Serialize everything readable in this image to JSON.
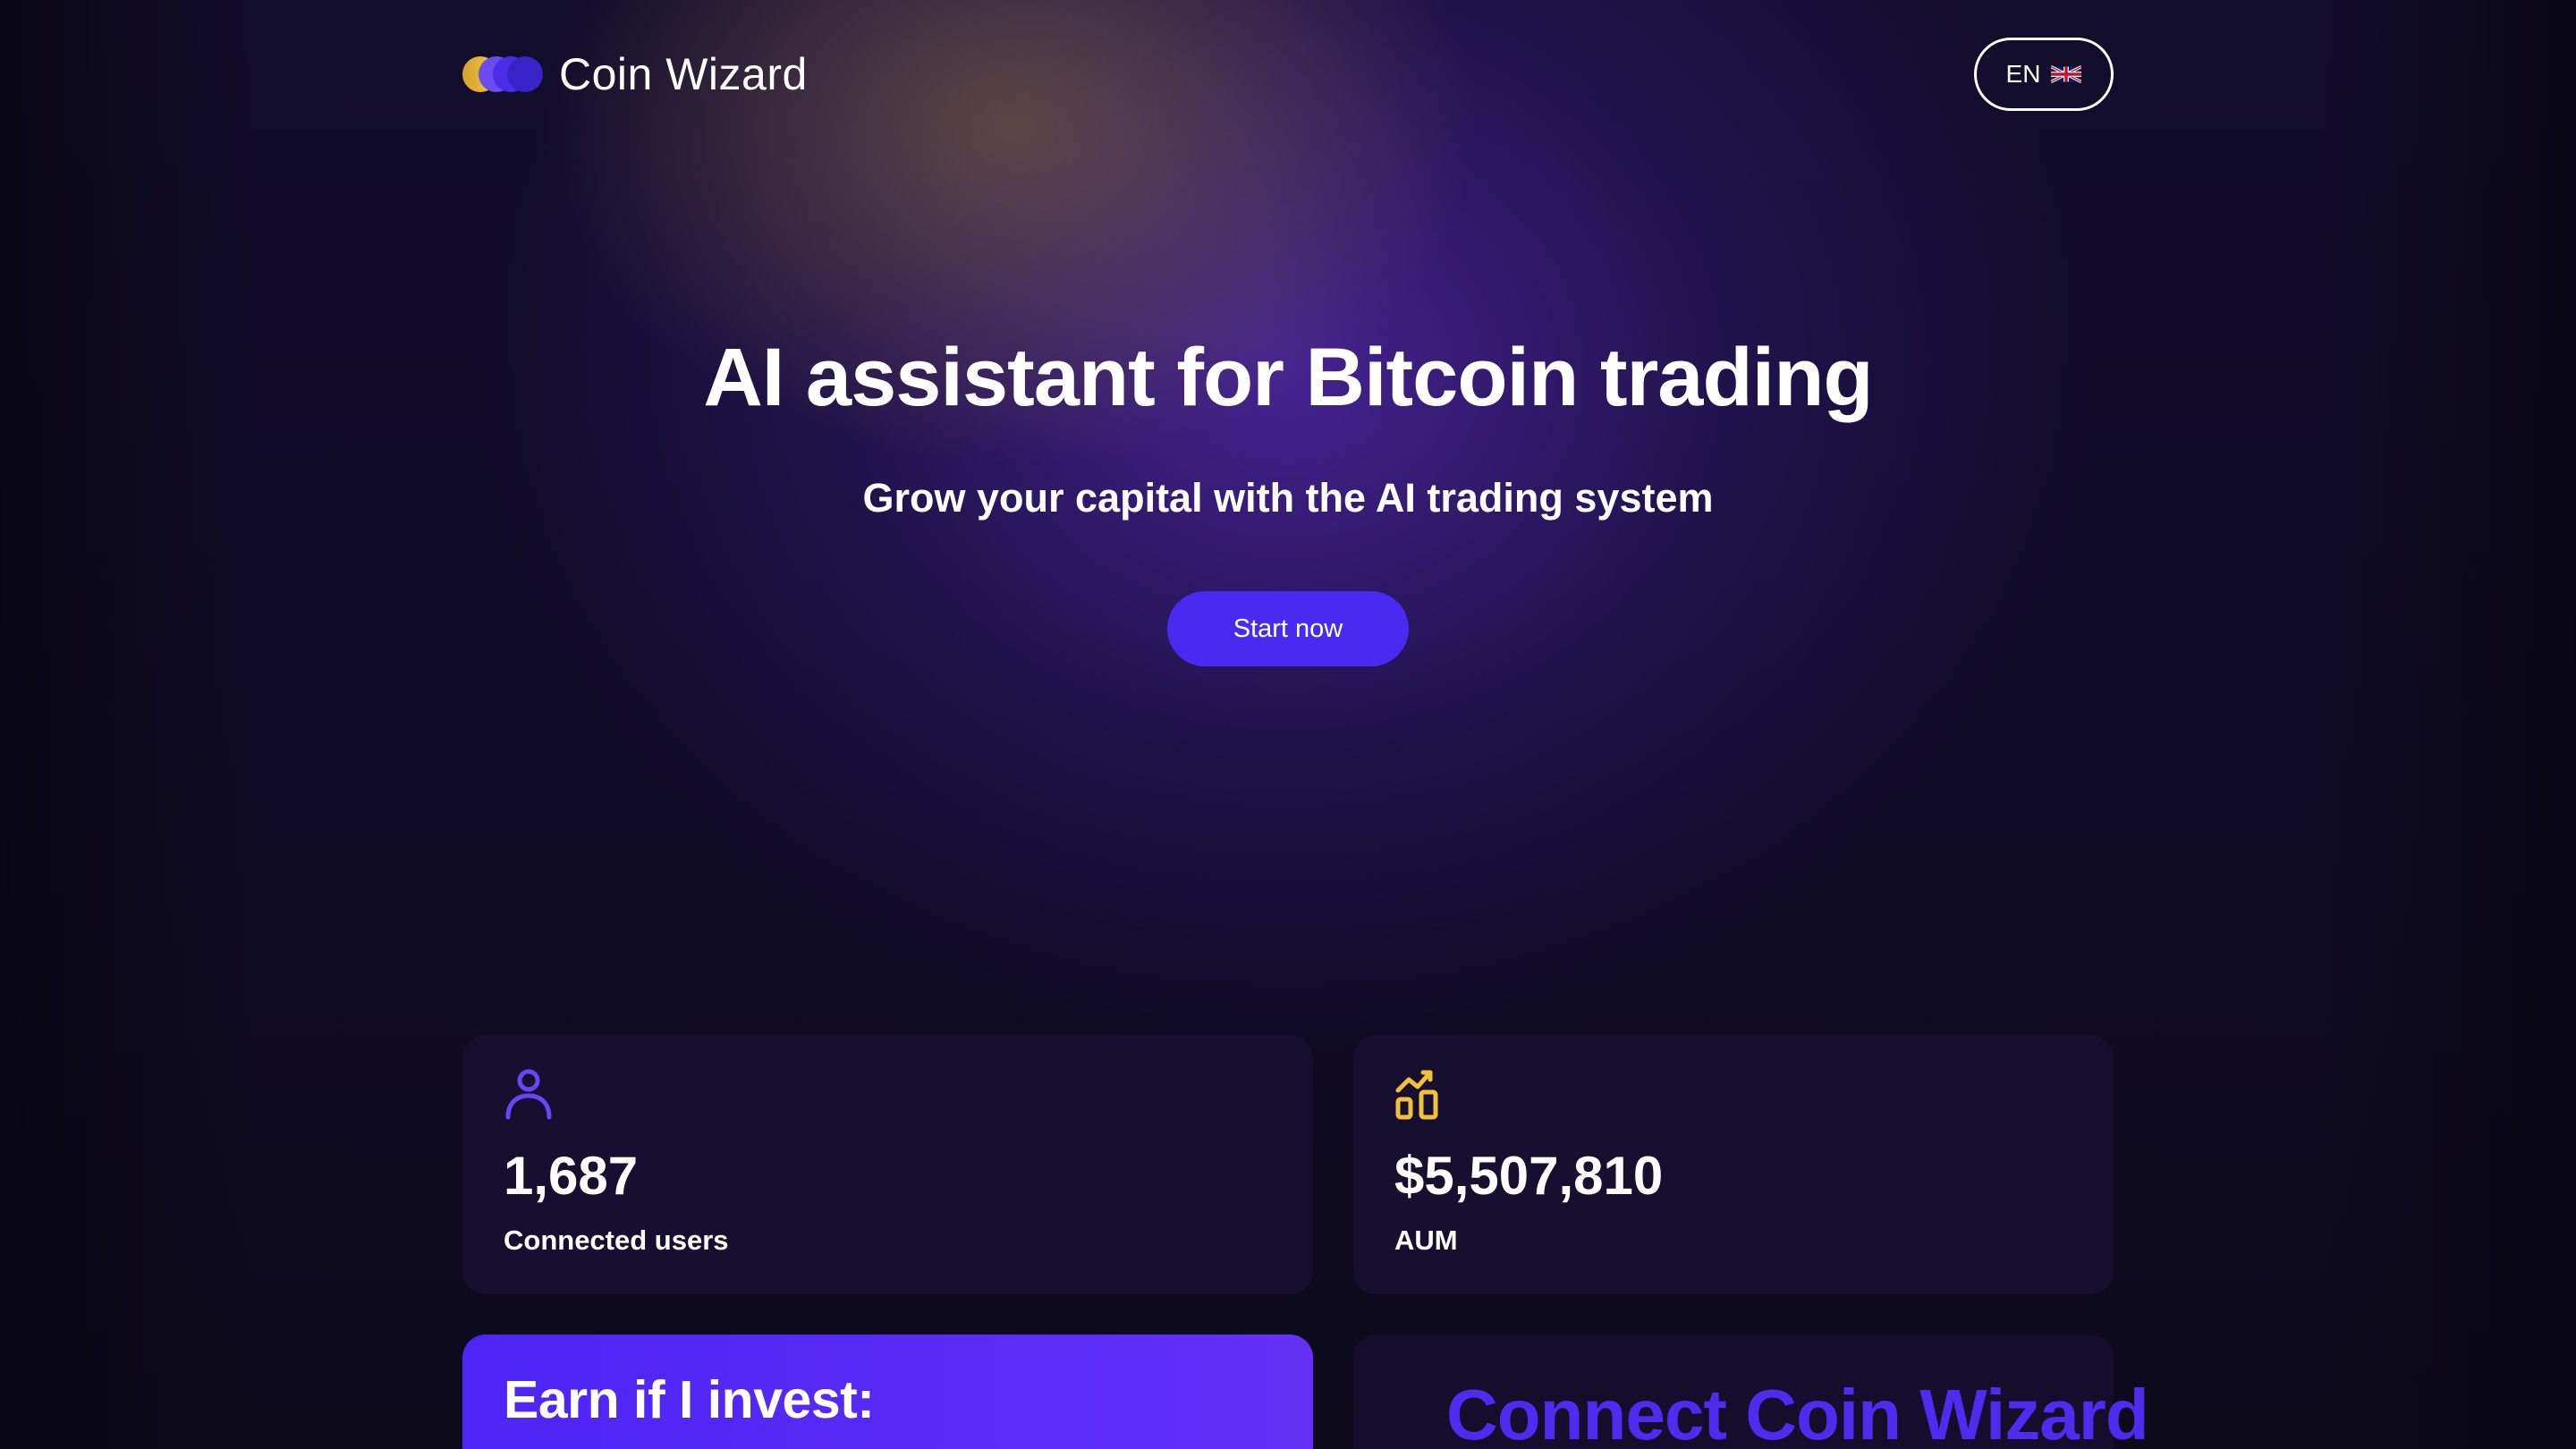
{
  "brand": {
    "name": "Coin Wizard",
    "logo_colors": [
      "#e6b43a",
      "#6a4cf0",
      "#4b2de8",
      "#3a22c9"
    ]
  },
  "header": {
    "language_label": "EN",
    "language_icon": "uk-flag-icon"
  },
  "hero": {
    "title": "AI assistant for Bitcoin trading",
    "subtitle": "Grow your capital with the AI trading system",
    "cta_label": "Start now",
    "cta_color": "#4a2af0"
  },
  "stats": [
    {
      "icon": "user-icon",
      "icon_color": "#6b45f5",
      "value": "1,687",
      "label": "Connected users"
    },
    {
      "icon": "chart-growth-icon",
      "icon_color": "#f0c23a",
      "value": "$5,507,810",
      "label": "AUM"
    }
  ],
  "earn_card": {
    "title": "Earn if I invest:",
    "background": "#5229f5"
  },
  "connect_card": {
    "title": "Connect Coin Wizard",
    "title_color": "#4d2cf0"
  }
}
